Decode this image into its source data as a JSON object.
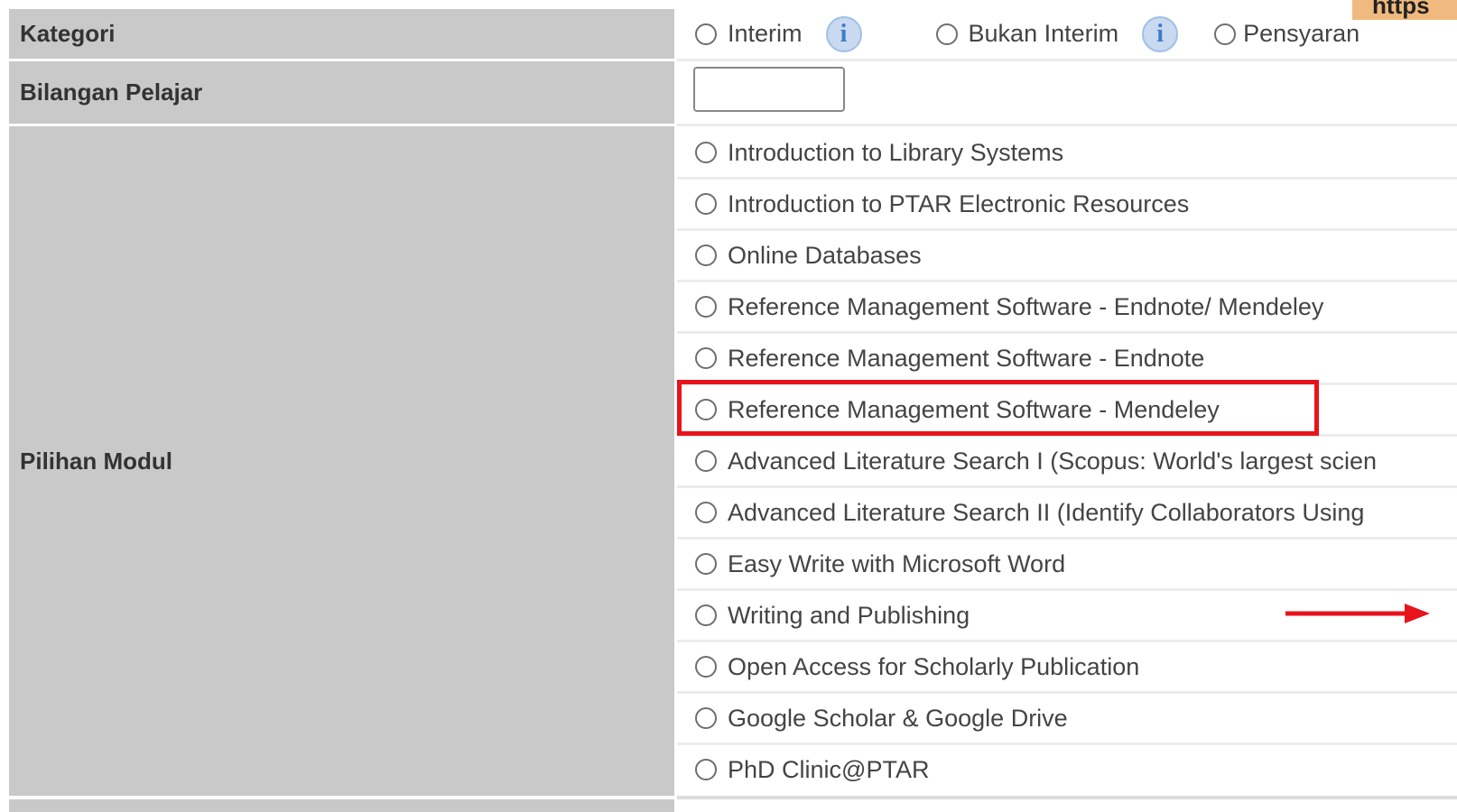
{
  "form": {
    "kategori": {
      "label": "Kategori",
      "options": [
        "Interim",
        "Bukan Interim",
        "Pensyaran"
      ]
    },
    "bilangan_pelajar": {
      "label": "Bilangan Pelajar",
      "value": ""
    },
    "pilihan_modul": {
      "label": "Pilihan Modul",
      "options": [
        "Introduction to Library Systems",
        "Introduction to PTAR Electronic Resources",
        "Online Databases",
        "Reference Management Software - Endnote/ Mendeley",
        "Reference Management Software - Endnote",
        "Reference Management Software - Mendeley",
        "Advanced Literature Search I (Scopus: World's largest scien",
        "Advanced Literature Search II (Identify Collaborators Using",
        "Easy Write with Microsoft Word",
        "Writing and Publishing",
        "Open Access for Scholarly Publication",
        "Google Scholar & Google Drive",
        "PhD Clinic@PTAR"
      ],
      "highlighted_index": 5
    }
  },
  "overlay": {
    "url_text": "https",
    "highlight_color": "#e8141b",
    "arrow_color": "#e8141b"
  }
}
